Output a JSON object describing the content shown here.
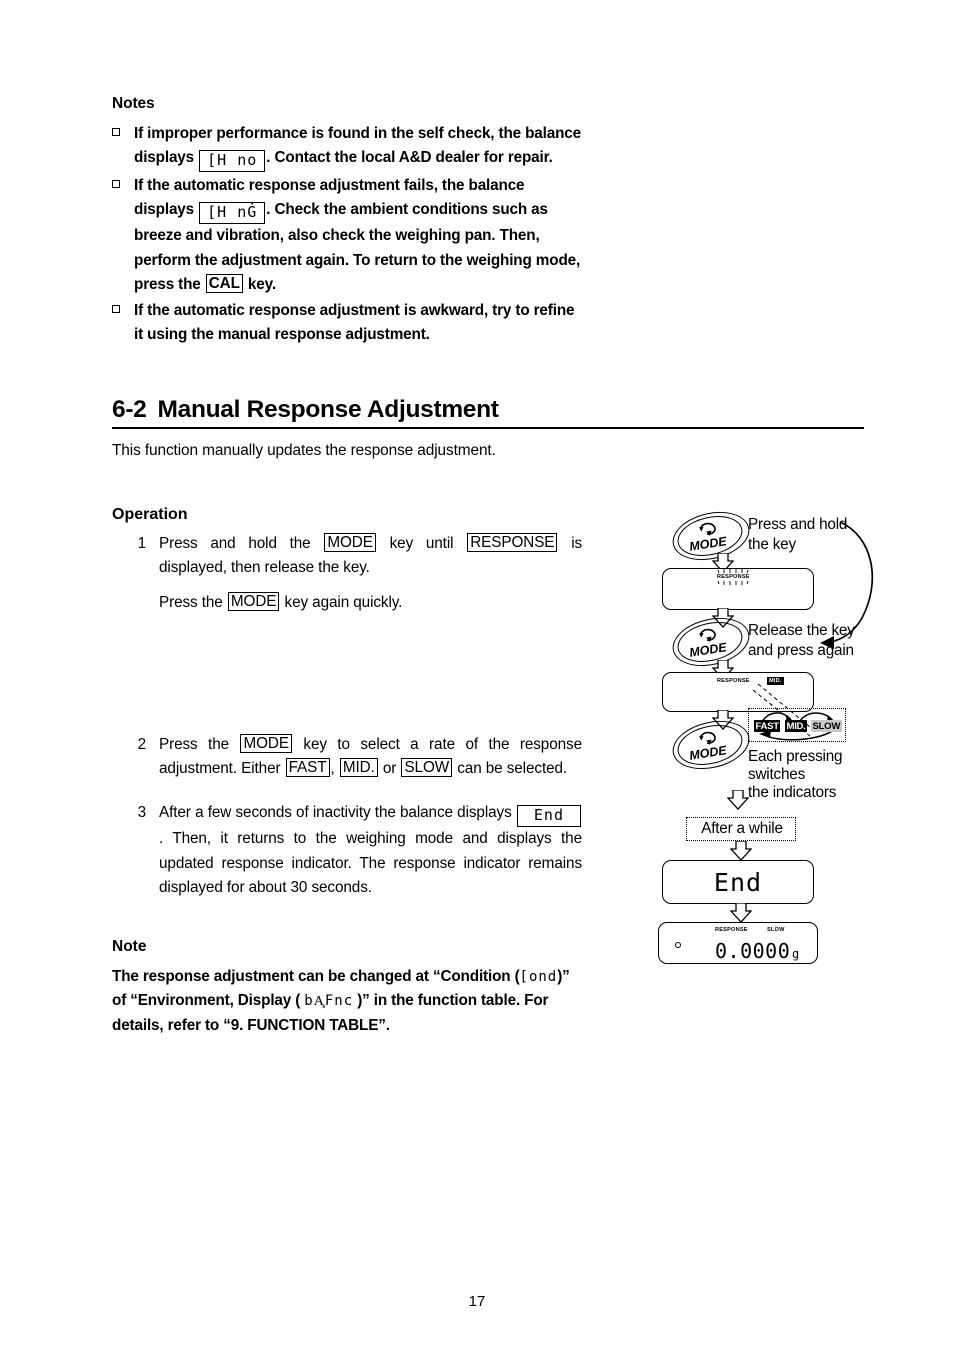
{
  "document": {
    "page_number": "17"
  },
  "notes_section": {
    "heading": "Notes",
    "bullets": [
      {
        "text_a": "If improper performance is found in the self check, the balance displays",
        "lcd": "[H  no",
        "text_b": ". Contact the local A&D dealer for repair."
      },
      {
        "text_a": "If the automatic response adjustment fails, the balance displays",
        "lcd": "[H  nĠ",
        "text_b": ". Check the ambient conditions such as breeze and vibration, also check the weighing pan. Then, perform the adjustment again. To return to the weighing mode, press the",
        "key": "CAL",
        "text_c": "key."
      },
      {
        "text_a": "If the automatic response adjustment is awkward, try to refine it using the manual response adjustment."
      }
    ]
  },
  "section": {
    "number": "6-2",
    "title": "Manual Response Adjustment",
    "intro": "This function manually updates the response adjustment."
  },
  "operation": {
    "heading": "Operation",
    "steps": [
      {
        "num": "1",
        "text_a": "Press and hold the",
        "key_a": "MODE",
        "text_b": "key until",
        "key_b": "RESPONSE",
        "text_c": "is displayed, then release the key.",
        "sub_text_a": "Press the",
        "sub_key": "MODE",
        "sub_text_b": "key again quickly."
      },
      {
        "num": "2",
        "text_a": "Press the",
        "key_a": "MODE",
        "text_b": "key to select a rate of the response adjustment. Either",
        "key_b": "FAST",
        "text_c": ",",
        "key_c": "MID.",
        "text_d": "or",
        "key_d": "SLOW",
        "text_e": "can be selected."
      },
      {
        "num": "3",
        "text_a": "After a few seconds of inactivity the balance displays",
        "lcd": "End",
        "text_b": ". Then, it returns to the weighing mode and displays the updated response indicator. The response indicator remains displayed for about 30 seconds."
      }
    ]
  },
  "bottom_note": {
    "heading": "Note",
    "text_a": "The response adjustment can be changed at “Condition (",
    "lcd_a": "[ond",
    "text_b": ")” of “Environment, Display (",
    "lcd_b": "bA͓Fnc",
    "text_c": ")” in the function table. For details, refer to “9. FUNCTION TABLE”."
  },
  "diagram": {
    "mode_key_label": "MODE",
    "captions": {
      "press_hold_l1": "Press and hold",
      "press_hold_l2": "the key",
      "release_l1": "Release the key",
      "release_l2": "and press again",
      "each_press_l1": "Each pressing",
      "each_press_l2": "switches",
      "each_press_l3": "the indicators",
      "after_a_while": "After a while"
    },
    "panels": {
      "panel1_indicator": "RESPONSE",
      "panel2_indicator": "RESPONSE",
      "panel2_chip": "MID.",
      "end_display": "End",
      "weight_indicator": "RESPONSE",
      "weight_rate": "SLOW",
      "weight_value": "0.0000",
      "weight_unit": "g"
    },
    "rates": [
      {
        "label": "FAST",
        "style": "black"
      },
      {
        "label": "MID.",
        "style": "black"
      },
      {
        "label": "SLOW",
        "style": "gray"
      }
    ]
  }
}
